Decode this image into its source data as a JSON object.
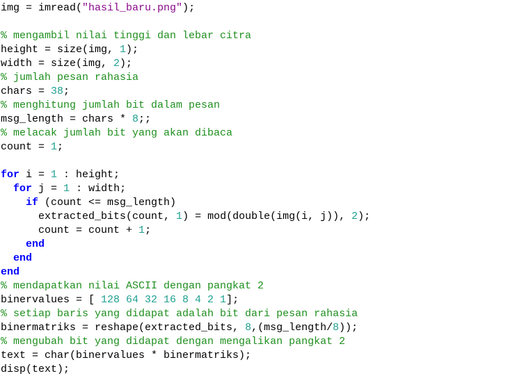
{
  "theme": {
    "background": "#ffffff",
    "text": "#000000",
    "keyword": "#0000ff",
    "number": "#20a090",
    "string": "#8a0a8a",
    "comment": "#1f8f1f"
  },
  "code": {
    "lines": [
      [
        [
          "t",
          "img = imread("
        ],
        [
          "s",
          "\"hasil_baru.png\""
        ],
        [
          "t",
          ");"
        ]
      ],
      [],
      [
        [
          "c",
          "% mengambil nilai tinggi dan lebar citra"
        ]
      ],
      [
        [
          "t",
          "height = size(img, "
        ],
        [
          "n",
          "1"
        ],
        [
          "t",
          ");"
        ]
      ],
      [
        [
          "t",
          "width = size(img, "
        ],
        [
          "n",
          "2"
        ],
        [
          "t",
          ");"
        ]
      ],
      [
        [
          "c",
          "% jumlah pesan rahasia"
        ]
      ],
      [
        [
          "t",
          "chars = "
        ],
        [
          "n",
          "38"
        ],
        [
          "t",
          ";"
        ]
      ],
      [
        [
          "c",
          "% menghitung jumlah bit dalam pesan"
        ]
      ],
      [
        [
          "t",
          "msg_length = chars * "
        ],
        [
          "n",
          "8"
        ],
        [
          "t",
          ";;"
        ]
      ],
      [
        [
          "c",
          "% melacak jumlah bit yang akan dibaca"
        ]
      ],
      [
        [
          "t",
          "count = "
        ],
        [
          "n",
          "1"
        ],
        [
          "t",
          ";"
        ]
      ],
      [],
      [
        [
          "k",
          "for"
        ],
        [
          "t",
          " i = "
        ],
        [
          "n",
          "1"
        ],
        [
          "t",
          " : height;"
        ]
      ],
      [
        [
          "t",
          "  "
        ],
        [
          "k",
          "for"
        ],
        [
          "t",
          " j = "
        ],
        [
          "n",
          "1"
        ],
        [
          "t",
          " : width;"
        ]
      ],
      [
        [
          "t",
          "    "
        ],
        [
          "k",
          "if"
        ],
        [
          "t",
          " (count <= msg_length)"
        ]
      ],
      [
        [
          "t",
          "      extracted_bits(count, "
        ],
        [
          "n",
          "1"
        ],
        [
          "t",
          ") = mod(double(img(i, j)), "
        ],
        [
          "n",
          "2"
        ],
        [
          "t",
          ");"
        ]
      ],
      [
        [
          "t",
          "      count = count + "
        ],
        [
          "n",
          "1"
        ],
        [
          "t",
          ";"
        ]
      ],
      [
        [
          "t",
          "    "
        ],
        [
          "k",
          "end"
        ]
      ],
      [
        [
          "t",
          "  "
        ],
        [
          "k",
          "end"
        ]
      ],
      [
        [
          "k",
          "end"
        ]
      ],
      [
        [
          "c",
          "% mendapatkan nilai ASCII dengan pangkat 2"
        ]
      ],
      [
        [
          "t",
          "binervalues = [ "
        ],
        [
          "n",
          "128 64 32 16 8 4 2 1"
        ],
        [
          "t",
          "];"
        ]
      ],
      [
        [
          "c",
          "% setiap baris yang didapat adalah bit dari pesan rahasia"
        ]
      ],
      [
        [
          "t",
          "binermatriks = reshape(extracted_bits, "
        ],
        [
          "n",
          "8"
        ],
        [
          "t",
          ",(msg_length/"
        ],
        [
          "n",
          "8"
        ],
        [
          "t",
          "));"
        ]
      ],
      [
        [
          "c",
          "% mengubah bit yang didapat dengan mengalikan pangkat 2"
        ]
      ],
      [
        [
          "t",
          "text = char(binervalues * binermatriks);"
        ]
      ],
      [
        [
          "t",
          "disp(text);"
        ]
      ]
    ]
  }
}
